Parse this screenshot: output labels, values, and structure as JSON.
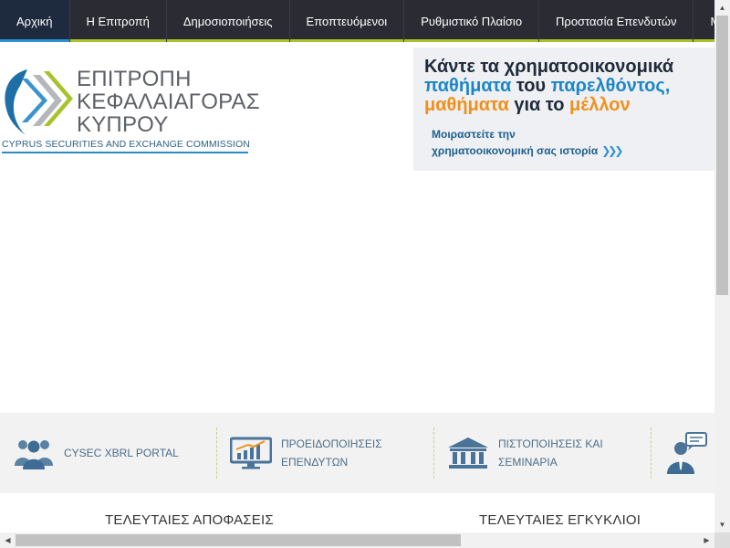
{
  "nav": {
    "items": [
      {
        "label": "Αρχική",
        "active": true
      },
      {
        "label": "Η Επιτροπή"
      },
      {
        "label": "Δημοσιοποιήσεις"
      },
      {
        "label": "Εποπτευόμενοι"
      },
      {
        "label": "Ρυθμιστικό Πλαίσιο"
      },
      {
        "label": "Προστασία Επενδυτών"
      },
      {
        "label": "Μητρώα"
      }
    ]
  },
  "logo": {
    "line1": "ΕΠΙΤΡΟΠΗ",
    "line2": "ΚΕΦΑΛΑΙΑΓΟΡΑΣ",
    "line3": "ΚΥΠΡΟΥ",
    "english": "CYPRUS SECURITIES AND EXCHANGE COMMISSION"
  },
  "banner": {
    "line1": "Κάντε τα χρηματοοικονομικά",
    "line2_a": "παθήματα",
    "line2_b": " του ",
    "line2_c": "παρελθόντος,",
    "line3_a": "μαθήματα",
    "line3_b": " για το ",
    "line3_c": "μέλλον",
    "cta_line1": "Μοιραστείτε την",
    "cta_line2": "χρηματοοικονομική σας ιστορία",
    "cta_arrows": "❯❯❯"
  },
  "quicklinks": [
    {
      "icon": "people-icon",
      "label": "CYSEC XBRL PORTAL"
    },
    {
      "icon": "chart-monitor-icon",
      "label_1": "ΠΡΟΕΙΔΟΠΟΙΗΣΕΙΣ",
      "label_2": "ΕΠΕΝΔΥΤΩΝ"
    },
    {
      "icon": "institution-icon",
      "label_1": "ΠΙΣΤΟΠΟΙΗΣΕΙΣ ΚΑΙ",
      "label_2": "ΣΕΜΙΝΑΡΙΑ"
    },
    {
      "icon": "support-person-icon"
    }
  ],
  "sections": {
    "decisions": "ΤΕΛΕΥΤΑΙΕΣ ΑΠΟΦΑΣΕΙΣ",
    "circulars": "ΤΕΛΕΥΤΑΙΕΣ ΕΓΚΥΚΛΙΟΙ"
  },
  "colors": {
    "nav_bg": "#2b2c33",
    "nav_accent": "#a7c22b",
    "active_accent": "#2f8fd1",
    "brand_blue": "#1e86c8",
    "brand_orange": "#f0901c"
  }
}
